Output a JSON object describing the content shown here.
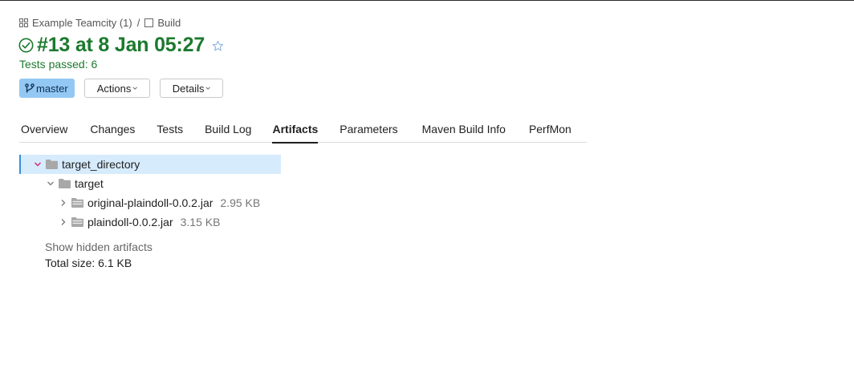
{
  "breadcrumb": {
    "project": "Example Teamcity (1)",
    "separator": "/",
    "build_config": "Build"
  },
  "build": {
    "title": "#13 at 8 Jan 05:27",
    "status_text": "Tests passed: 6",
    "status_color": "#1c7a2e"
  },
  "controls": {
    "branch": "master",
    "actions_label": "Actions",
    "details_label": "Details"
  },
  "tabs": [
    {
      "label": "Overview",
      "active": false
    },
    {
      "label": "Changes",
      "active": false
    },
    {
      "label": "Tests",
      "active": false
    },
    {
      "label": "Build Log",
      "active": false
    },
    {
      "label": "Artifacts",
      "active": true
    },
    {
      "label": "Parameters",
      "active": false
    },
    {
      "label": "Maven Build Info",
      "active": false
    },
    {
      "label": "PerfMon",
      "active": false
    }
  ],
  "artifacts": {
    "root": {
      "name": "target_directory",
      "expanded": true,
      "selected": true
    },
    "child": {
      "name": "target",
      "expanded": true
    },
    "files": [
      {
        "name": "original-plaindoll-0.0.2.jar",
        "size": "2.95 KB"
      },
      {
        "name": "plaindoll-0.0.2.jar",
        "size": "3.15 KB"
      }
    ],
    "show_hidden_label": "Show hidden artifacts",
    "total_size": "Total size: 6.1 KB"
  },
  "colors": {
    "accent": "#1c7a2e",
    "branch_chip": "#93c8f4",
    "selection": "#d6ebfc",
    "chevron_root": "#d6246e"
  }
}
